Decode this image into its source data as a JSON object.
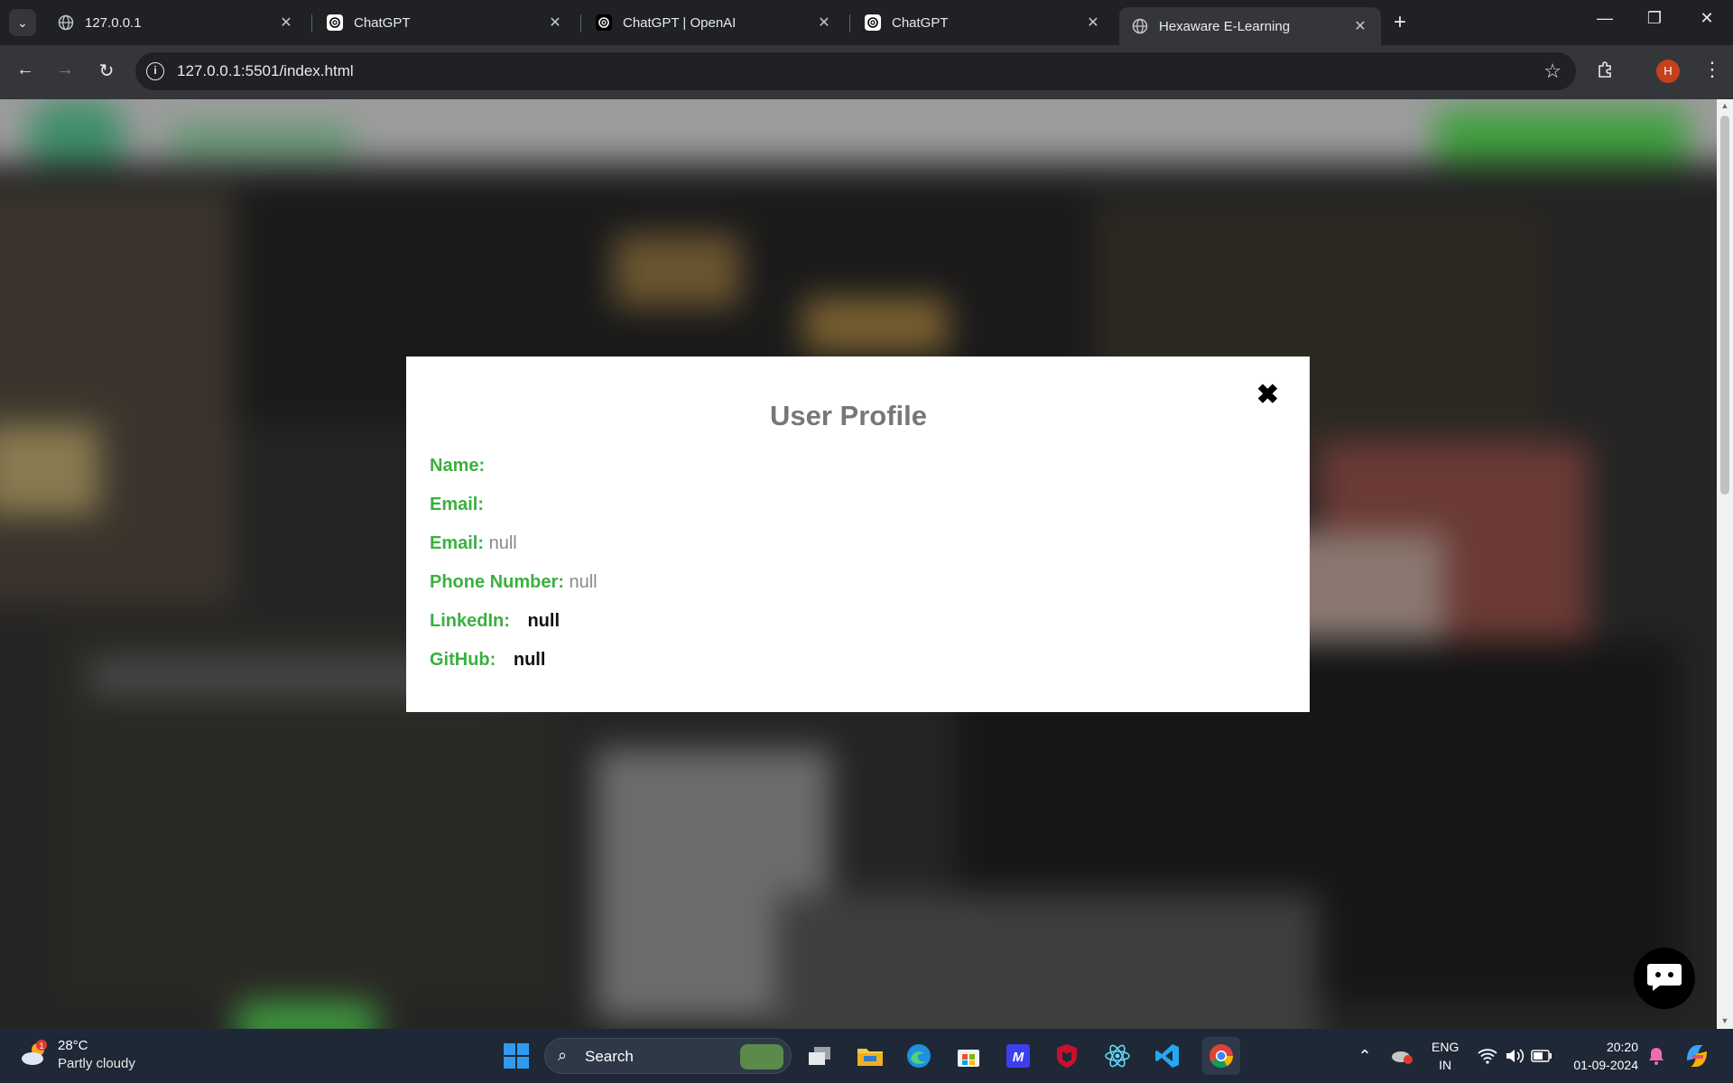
{
  "browser": {
    "tabs": [
      {
        "title": "127.0.0.1",
        "icon": "globe-icon"
      },
      {
        "title": "ChatGPT",
        "icon": "chatgpt-icon"
      },
      {
        "title": "ChatGPT | OpenAI",
        "icon": "openai-icon"
      },
      {
        "title": "ChatGPT",
        "icon": "chatgpt-icon"
      },
      {
        "title": "Hexaware E-Learning",
        "icon": "globe-icon",
        "active": true
      }
    ],
    "url": "127.0.0.1:5501/index.html",
    "profile_initial": "H"
  },
  "modal": {
    "title": "User Profile",
    "close_symbol": "✖",
    "fields": [
      {
        "label": "Name:",
        "value": ""
      },
      {
        "label": "Email:",
        "value": ""
      },
      {
        "label": "Email:",
        "value": "null"
      },
      {
        "label": "Phone Number:",
        "value": "null"
      },
      {
        "label": "LinkedIn:",
        "value": "null"
      },
      {
        "label": "GitHub:",
        "value": "null"
      }
    ]
  },
  "taskbar": {
    "weather": {
      "temp": "28°C",
      "desc": "Partly cloudy",
      "badge": "1"
    },
    "search_label": "Search",
    "lang_line1": "ENG",
    "lang_line2": "IN",
    "time": "20:20",
    "date": "01-09-2024"
  },
  "colors": {
    "label_green": "#3bb03f",
    "title_grey": "#777777",
    "value_grey": "#8a8a8a"
  }
}
